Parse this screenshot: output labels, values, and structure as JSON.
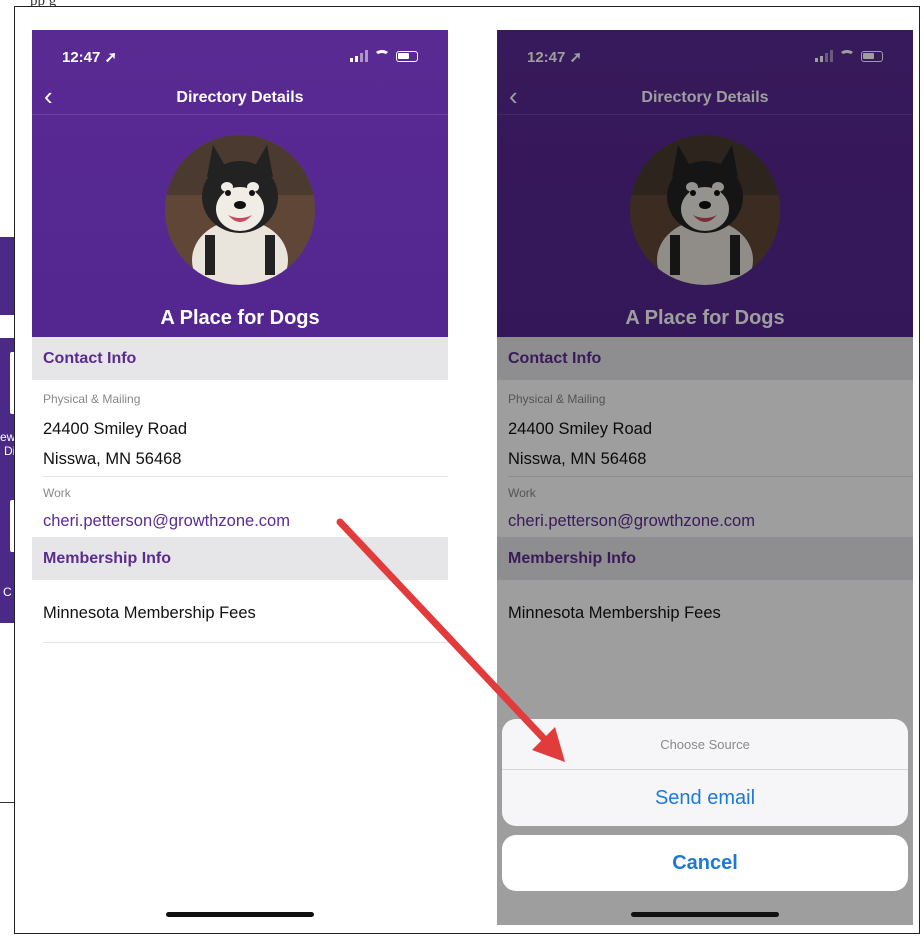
{
  "screens": [
    {
      "status_time": "12:47",
      "nav_title": "Directory Details",
      "org_name": "A Place for Dogs",
      "contact_header": "Contact Info",
      "address_label": "Physical & Mailing",
      "address_line1": "24400 Smiley Road",
      "address_line2": "Nisswa, MN 56468",
      "email_label": "Work",
      "email": "cheri.petterson@growthzone.com",
      "membership_header": "Membership Info",
      "membership_item": "Minnesota Membership Fees"
    },
    {
      "status_time": "12:47",
      "nav_title": "Directory Details",
      "org_name": "A Place for Dogs",
      "contact_header": "Contact Info",
      "address_label": "Physical & Mailing",
      "address_line1": "24400 Smiley Road",
      "address_line2": "Nisswa, MN 56468",
      "email_label": "Work",
      "email": "cheri.petterson@growthzone.com",
      "membership_header": "Membership Info",
      "membership_item": "Minnesota Membership Fees",
      "action_sheet": {
        "title": "Choose Source",
        "option": "Send email",
        "cancel": "Cancel"
      }
    }
  ],
  "background_fragments": {
    "top_text": "pp  g",
    "side_text_1": "ew",
    "side_text_2": "Di",
    "side_text_3": "C"
  },
  "colors": {
    "brand_purple": "#5a2a93",
    "link_blue": "#1e78d9",
    "arrow_red": "#e23b3b"
  },
  "icons": [
    "back-chevron-icon",
    "signal-icon",
    "wifi-icon",
    "battery-icon",
    "location-arrow-icon"
  ]
}
